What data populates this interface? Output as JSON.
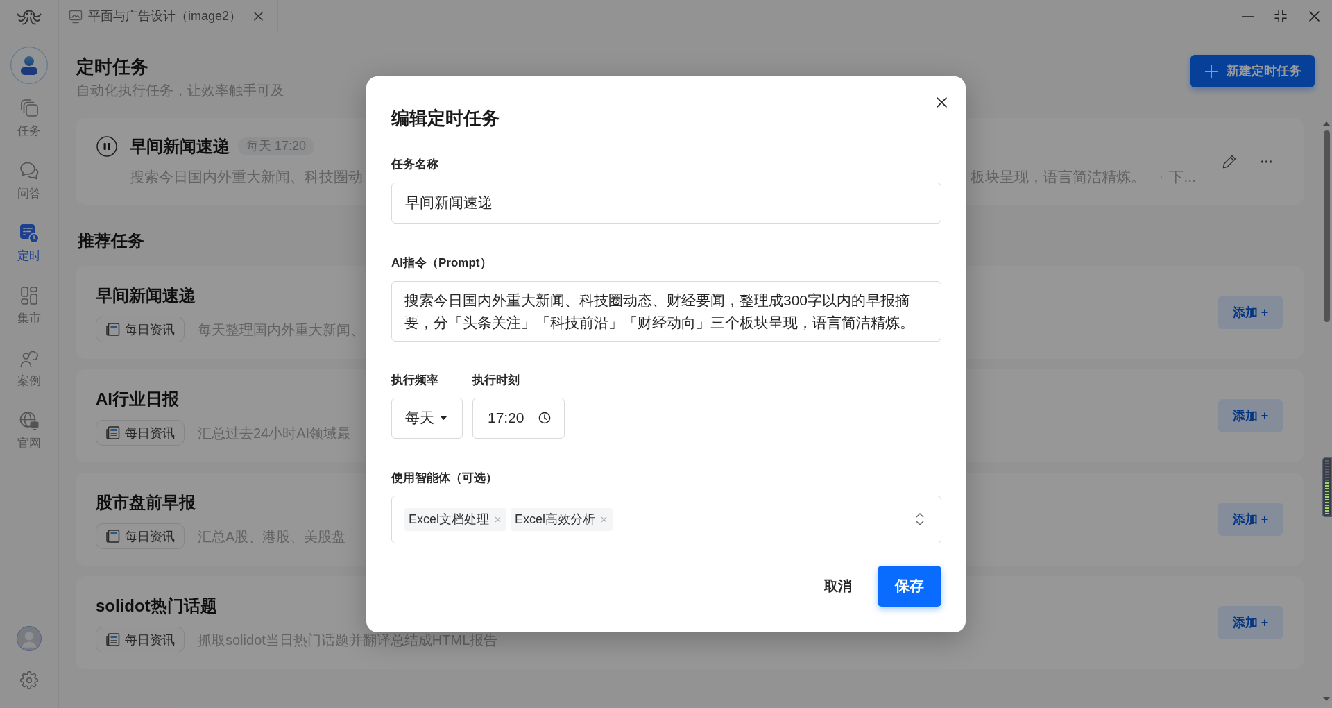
{
  "title_bar": {
    "tabs": [
      {
        "label": "平面与广告设计（image2）"
      }
    ]
  },
  "sidebar": {
    "items": [
      {
        "label": "任务",
        "selected": false
      },
      {
        "label": "问答",
        "selected": false
      },
      {
        "label": "定时",
        "selected": true
      },
      {
        "label": "集市",
        "selected": false
      },
      {
        "label": "案例",
        "selected": false
      },
      {
        "label": "官网",
        "selected": false
      }
    ]
  },
  "header": {
    "title": "定时任务",
    "subtitle": "自动化执行任务，让效率触手可及",
    "new_button": "新建定时任务"
  },
  "scheduled_tasks": [
    {
      "title": "早间新闻速递",
      "running": true,
      "schedule": "每天 17:20",
      "description_visible_start": "搜索今日国内外重大新闻、科技圈动",
      "description_visible_end": "板块呈现，语言简洁精炼。",
      "separator": "·",
      "next_run": "下..."
    }
  ],
  "recommended": {
    "heading": "推荐任务",
    "items": [
      {
        "title": "早间新闻速递",
        "tag": "每日资讯",
        "description": "每天整理国内外重大新闻、",
        "add_button": "添加 +"
      },
      {
        "title": "AI行业日报",
        "tag": "每日资讯",
        "description": "汇总过去24小时AI领域最",
        "add_button": "添加 +"
      },
      {
        "title": "股市盘前早报",
        "tag": "每日资讯",
        "description": "汇总A股、港股、美股盘",
        "add_button": "添加 +"
      },
      {
        "title": "solidot热门话题",
        "tag": "每日资讯",
        "description": "抓取solidot当日热门话题并翻译总结成HTML报告",
        "add_button": "添加 +"
      }
    ]
  },
  "dialog": {
    "title": "编辑定时任务",
    "name_field": {
      "label": "任务名称",
      "value": "早间新闻速递"
    },
    "prompt_field": {
      "label": "AI指令（Prompt）",
      "value": "搜索今日国内外重大新闻、科技圈动态、财经要闻，整理成300字以内的早报摘要，分「头条关注」「科技前沿」「财经动向」三个板块呈现，语言简洁精炼。"
    },
    "frequency_field": {
      "label": "执行频率",
      "value": "每天"
    },
    "time_field": {
      "label": "执行时刻",
      "value": "17:20"
    },
    "agents_field": {
      "label": "使用智能体（可选）",
      "chips": [
        "Excel文档处理",
        "Excel高效分析"
      ]
    },
    "buttons": [
      {
        "label": "取消",
        "kind": "secondary"
      },
      {
        "label": "保存",
        "kind": "primary"
      }
    ]
  },
  "level_meter": {
    "level": 0.62
  }
}
